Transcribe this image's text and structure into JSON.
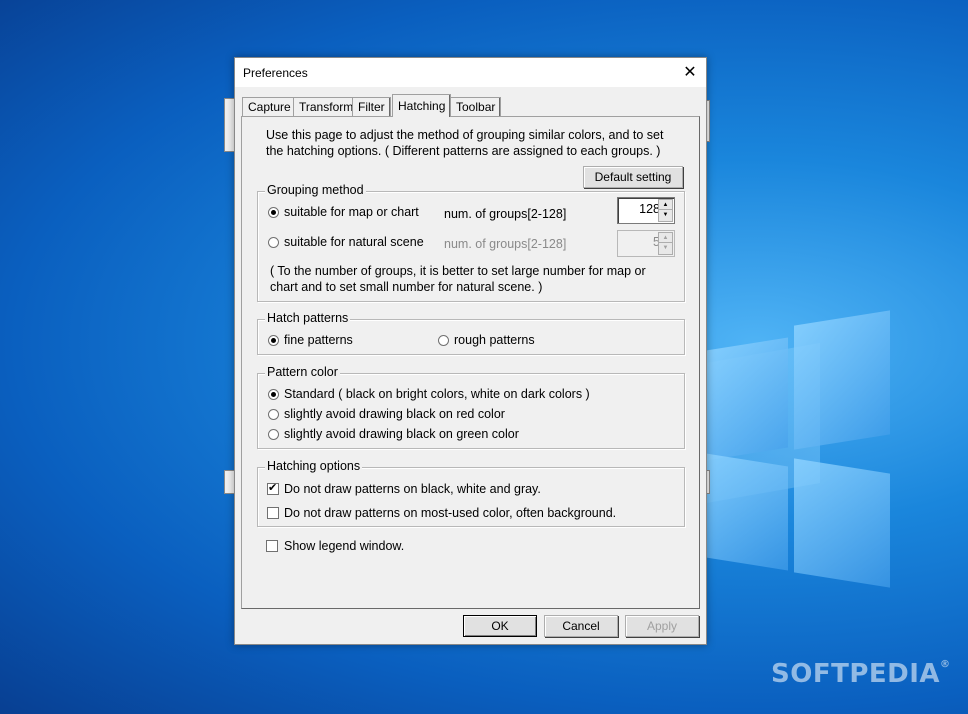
{
  "watermark": "SOFTPEDIA",
  "watermark_mark": "®",
  "dialog": {
    "title": "Preferences",
    "close_glyph": "✕",
    "tabs": [
      "Capture",
      "Transform",
      "Filter",
      "Hatching",
      "Toolbar"
    ],
    "active_tab": "Hatching",
    "description": "Use this page to adjust the method of grouping similar colors, and to set the hatching options. ( Different patterns are assigned to each groups. )",
    "default_setting_button": "Default setting",
    "grouping": {
      "legend": "Grouping method",
      "option1": "suitable for map or chart",
      "option1_groups_label": "num. of groups[2-128]",
      "option1_groups_value": "128",
      "option2": "suitable for natural scene",
      "option2_groups_label": "num. of groups[2-128]",
      "option2_groups_value": "5",
      "note": "( To the number of groups, it is better to set large number for map or chart and to set small number for natural scene. )",
      "selected": "option1"
    },
    "hatch_patterns": {
      "legend": "Hatch patterns",
      "fine": "fine patterns",
      "rough": "rough patterns",
      "selected": "fine"
    },
    "pattern_color": {
      "legend": "Pattern color",
      "standard": "Standard ( black on bright colors, white on dark colors )",
      "avoid_red": "slightly avoid drawing black on red color",
      "avoid_green": "slightly avoid drawing black on green color",
      "selected": "standard"
    },
    "hatching_options": {
      "legend": "Hatching options",
      "opt_black_white_gray": "Do not draw patterns on black, white and gray.",
      "opt_black_white_gray_checked": true,
      "opt_most_used": "Do not draw patterns on most-used color, often background.",
      "opt_most_used_checked": false
    },
    "show_legend": "Show legend window.",
    "show_legend_checked": false,
    "buttons": {
      "ok": "OK",
      "cancel": "Cancel",
      "apply": "Apply"
    }
  }
}
